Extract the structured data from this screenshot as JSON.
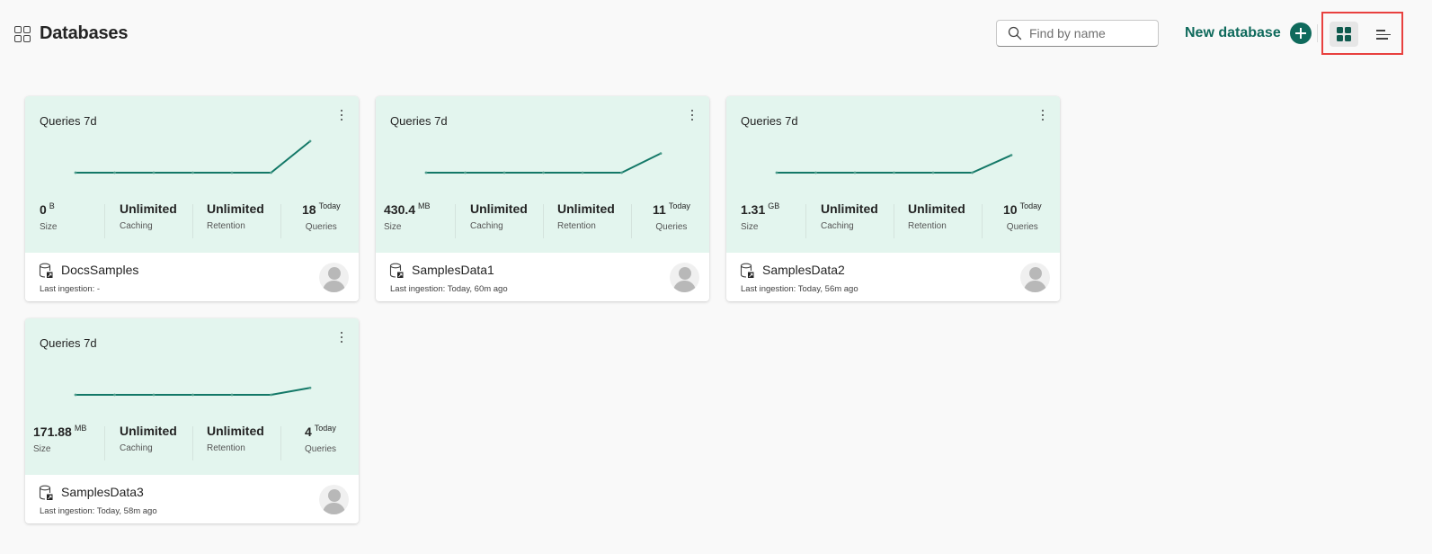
{
  "header": {
    "title": "Databases",
    "title_icon": "apps-grid-icon",
    "search": {
      "placeholder": "Find by name",
      "value": ""
    },
    "new_database_label": "New database",
    "view_modes": [
      {
        "name": "grid-view",
        "icon": "grid-icon",
        "selected": true
      },
      {
        "name": "list-view",
        "icon": "list-icon",
        "selected": false
      }
    ]
  },
  "colors": {
    "accent": "#0f6a5c",
    "card_top_bg": "#e3f5ee",
    "spark_line": "#137867",
    "highlight_box": "#e8413f"
  },
  "cards": [
    {
      "chart_label": "Queries 7d",
      "spark": [
        0,
        0,
        0,
        0,
        0,
        0,
        18
      ],
      "size": {
        "value": "0",
        "unit": "B",
        "label": "Size"
      },
      "caching": {
        "value": "Unlimited",
        "label": "Caching"
      },
      "retention": {
        "value": "Unlimited",
        "label": "Retention"
      },
      "queries": {
        "value": "18",
        "unit": "Today",
        "label": "Queries"
      },
      "name": "DocsSamples",
      "last_ingestion": "Last ingestion: -"
    },
    {
      "chart_label": "Queries 7d",
      "spark": [
        0,
        0,
        0,
        0,
        0,
        0,
        11
      ],
      "size": {
        "value": "430.4",
        "unit": "MB",
        "label": "Size"
      },
      "caching": {
        "value": "Unlimited",
        "label": "Caching"
      },
      "retention": {
        "value": "Unlimited",
        "label": "Retention"
      },
      "queries": {
        "value": "11",
        "unit": "Today",
        "label": "Queries"
      },
      "name": "SamplesData1",
      "last_ingestion": "Last ingestion: Today, 60m ago"
    },
    {
      "chart_label": "Queries 7d",
      "spark": [
        0,
        0,
        0,
        0,
        0,
        0,
        10
      ],
      "size": {
        "value": "1.31",
        "unit": "GB",
        "label": "Size"
      },
      "caching": {
        "value": "Unlimited",
        "label": "Caching"
      },
      "retention": {
        "value": "Unlimited",
        "label": "Retention"
      },
      "queries": {
        "value": "10",
        "unit": "Today",
        "label": "Queries"
      },
      "name": "SamplesData2",
      "last_ingestion": "Last ingestion: Today, 56m ago"
    },
    {
      "chart_label": "Queries 7d",
      "spark": [
        0,
        0,
        0,
        0,
        0,
        0,
        4
      ],
      "size": {
        "value": "171.88",
        "unit": "MB",
        "label": "Size"
      },
      "caching": {
        "value": "Unlimited",
        "label": "Caching"
      },
      "retention": {
        "value": "Unlimited",
        "label": "Retention"
      },
      "queries": {
        "value": "4",
        "unit": "Today",
        "label": "Queries"
      },
      "name": "SamplesData3",
      "last_ingestion": "Last ingestion: Today, 58m ago"
    }
  ]
}
